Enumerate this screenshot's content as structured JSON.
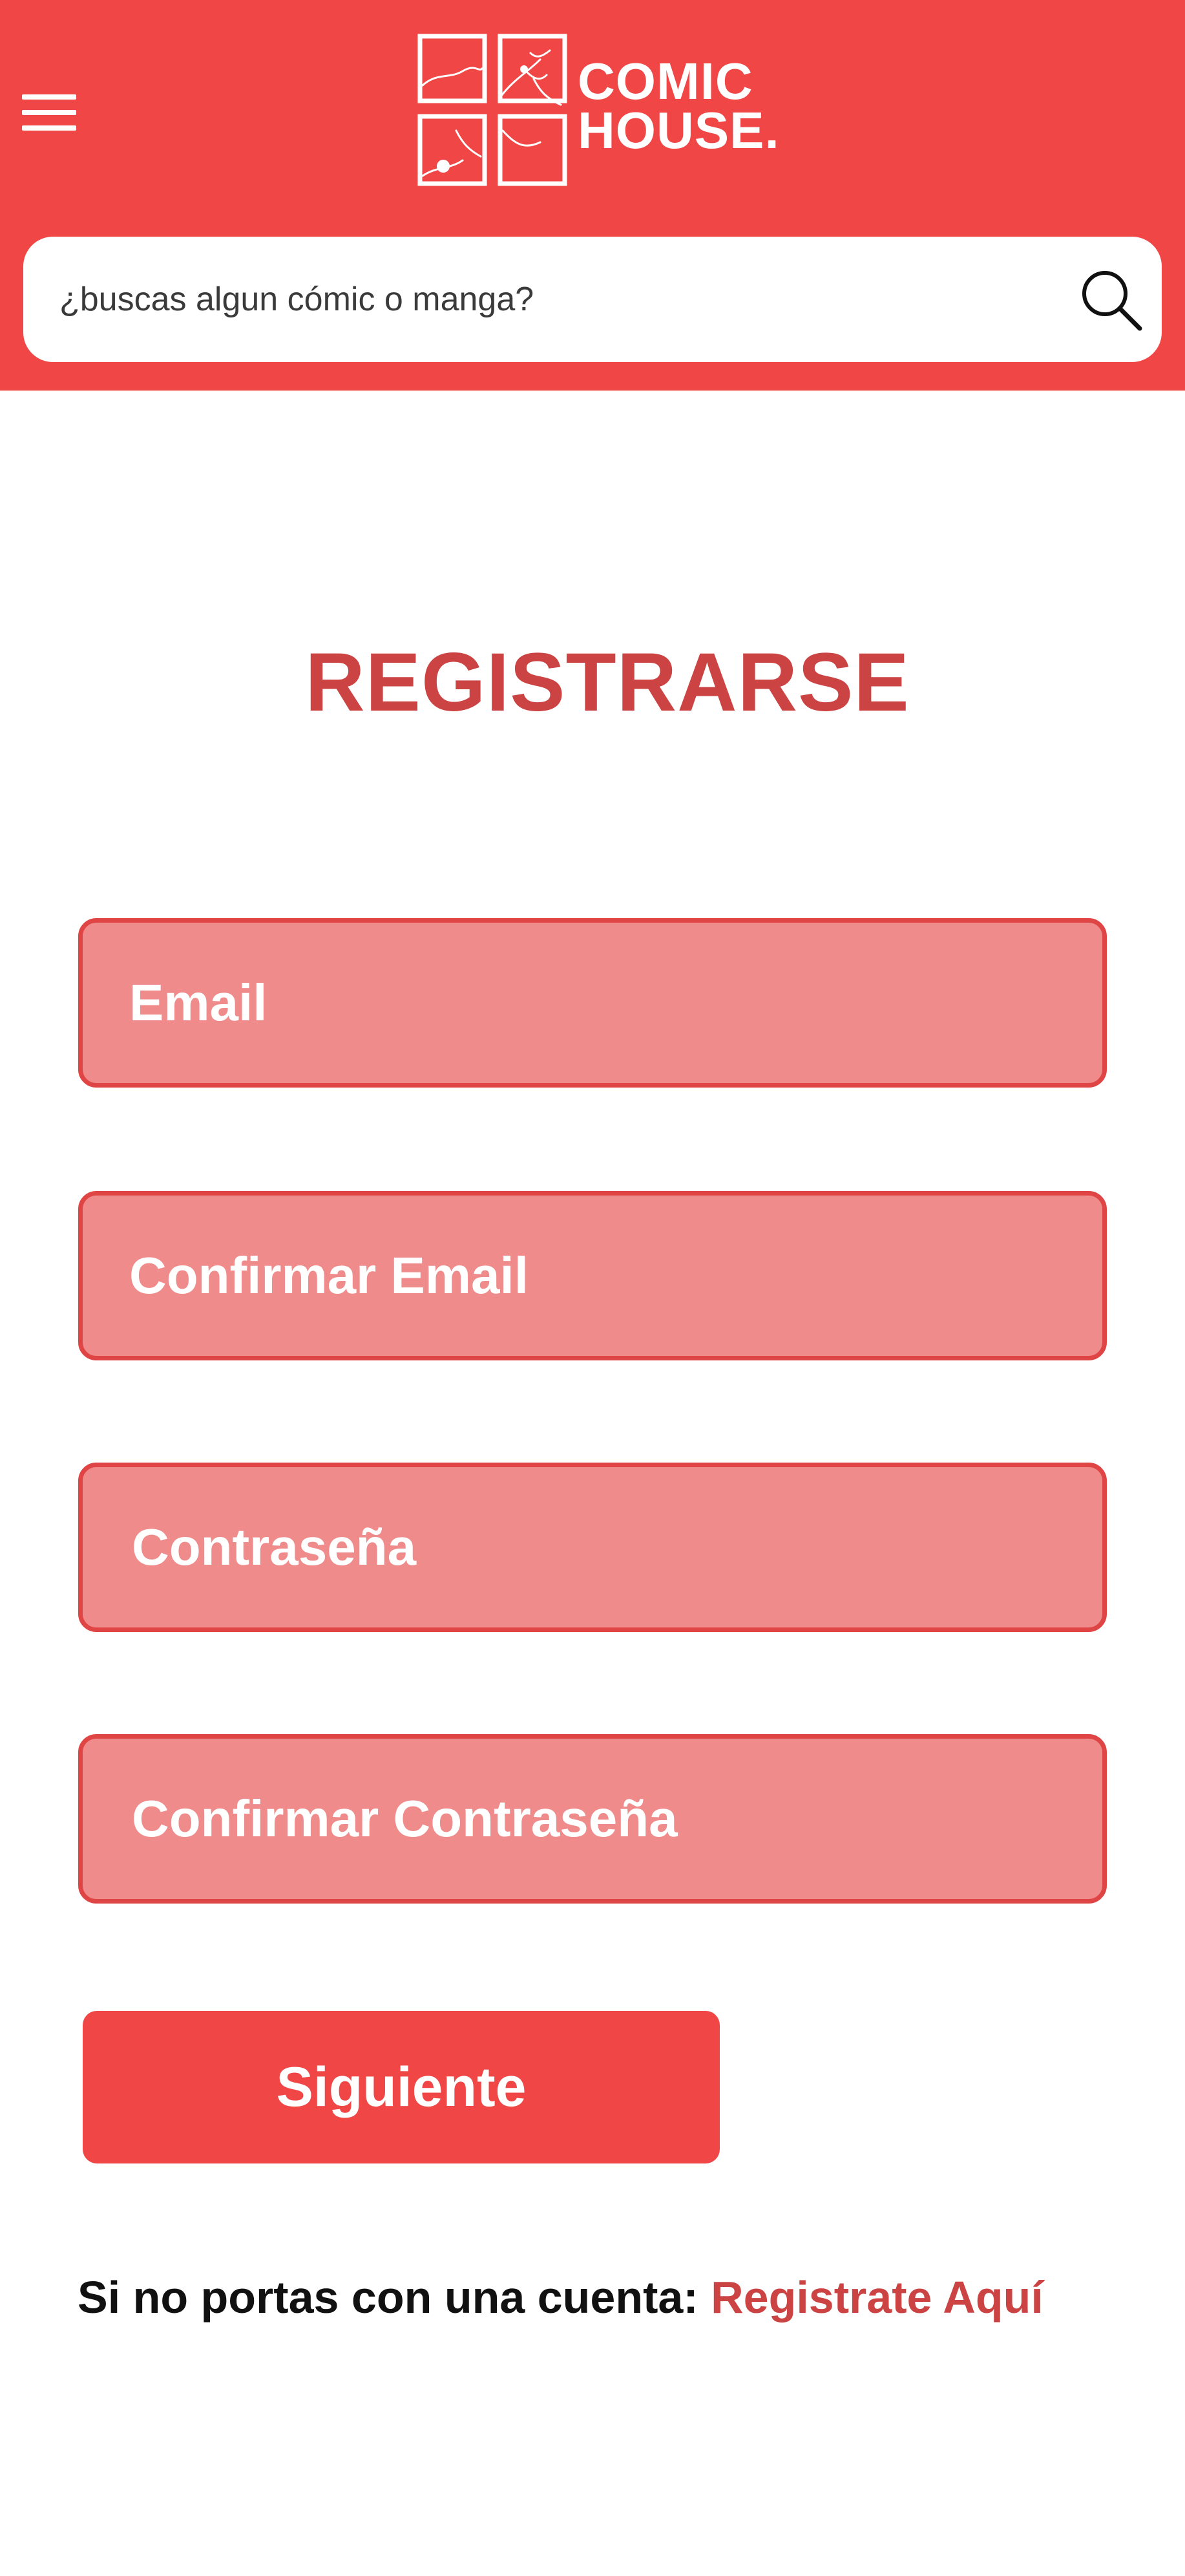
{
  "header": {
    "brand_line1": "COMIC",
    "brand_line2": "HOUSE.",
    "menu_icon": "hamburger-menu-icon",
    "logo_icon": "comic-panels-logo-icon",
    "background_color": "#f04646"
  },
  "search": {
    "placeholder": "¿buscas algun cómic o manga?",
    "value": "",
    "icon": "search-icon"
  },
  "main": {
    "title": "REGISTRARSE",
    "fields": [
      {
        "label": "Email"
      },
      {
        "label": "Confirmar Email"
      },
      {
        "label": "Contraseña"
      },
      {
        "label": "Confirmar Contraseña"
      }
    ],
    "next_button_label": "Siguiente",
    "footer_prompt": "Si no portas con una cuenta:",
    "footer_link": "Registrate Aquí"
  },
  "colors": {
    "brand_red": "#f04646",
    "title_red": "#cc4343",
    "field_fill": "#f08b8b",
    "field_border": "#e04545"
  }
}
